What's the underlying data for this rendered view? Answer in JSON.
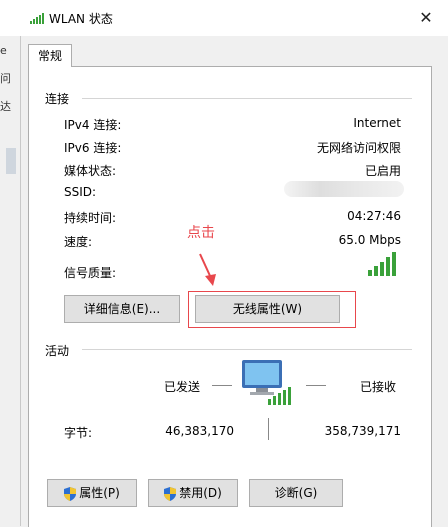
{
  "window": {
    "title": "WLAN 状态",
    "close_label": "✕",
    "left_fragments": [
      "e",
      "问",
      "达"
    ]
  },
  "tabs": [
    {
      "label": "常规"
    }
  ],
  "connection": {
    "section_label": "连接",
    "rows": [
      {
        "label": "IPv4 连接:",
        "value": "Internet"
      },
      {
        "label": "IPv6 连接:",
        "value": "无网络访问权限"
      },
      {
        "label": "媒体状态:",
        "value": "已启用"
      },
      {
        "label": "SSID:",
        "value": ""
      },
      {
        "label": "持续时间:",
        "value": "04:27:46"
      },
      {
        "label": "速度:",
        "value": "65.0 Mbps"
      },
      {
        "label": "信号质量:",
        "value": ""
      }
    ],
    "signal_bars": 5,
    "details_button": "详细信息(E)...",
    "wireless_props_button": "无线属性(W)"
  },
  "annotation": {
    "text": "点击",
    "color": "#e8474c"
  },
  "activity": {
    "section_label": "活动",
    "sent_label": "已发送",
    "received_label": "已接收",
    "bytes_label": "字节:",
    "bytes_sent": "46,383,170",
    "bytes_received": "358,739,171"
  },
  "footer": {
    "properties_button": "属性(P)",
    "disable_button": "禁用(D)",
    "diagnose_button": "诊断(G)"
  },
  "colors": {
    "signal_green": "#3aa13a",
    "shield_blue": "#2c6fd1",
    "shield_yellow": "#f2c531"
  }
}
